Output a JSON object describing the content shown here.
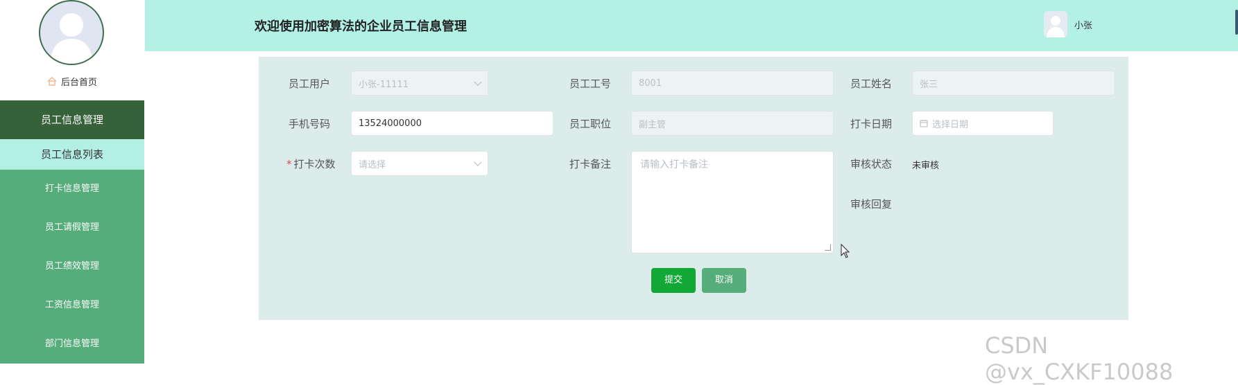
{
  "sidebar": {
    "home_label": "后台首页",
    "menu": [
      {
        "label": "员工信息管理",
        "state": "active"
      },
      {
        "label": "员工信息列表",
        "state": "sub"
      },
      {
        "label": "打卡信息管理",
        "state": "normal"
      },
      {
        "label": "员工请假管理",
        "state": "normal"
      },
      {
        "label": "员工绩效管理",
        "state": "normal"
      },
      {
        "label": "工资信息管理",
        "state": "normal"
      },
      {
        "label": "部门信息管理",
        "state": "normal"
      }
    ]
  },
  "header": {
    "title": "欢迎使用加密算法的企业员工信息管理",
    "username": "小张"
  },
  "form": {
    "employee_user_label": "员工用户",
    "employee_user_value": "小张-11111",
    "employee_id_label": "员工工号",
    "employee_id_value": "8001",
    "employee_name_label": "员工姓名",
    "employee_name_value": "张三",
    "phone_label": "手机号码",
    "phone_value": "13524000000",
    "position_label": "员工职位",
    "position_value": "副主管",
    "checkin_date_label": "打卡日期",
    "checkin_date_placeholder": "选择日期",
    "checkin_count_label": "打卡次数",
    "checkin_count_placeholder": "请选择",
    "remark_label": "打卡备注",
    "remark_placeholder": "请输入打卡备注",
    "review_status_label": "审核状态",
    "review_status_value": "未审核",
    "review_reply_label": "审核回复",
    "submit_label": "提交",
    "cancel_label": "取消"
  },
  "watermark": "CSDN @vx_CXKF10088",
  "colors": {
    "sidebar_menu": "#55ad79",
    "sidebar_active": "#356239",
    "sidebar_sub": "#b3efe2",
    "header_bg": "#b3f1e5",
    "panel_bg": "#dbeceb",
    "submit_button": "#12a836"
  }
}
